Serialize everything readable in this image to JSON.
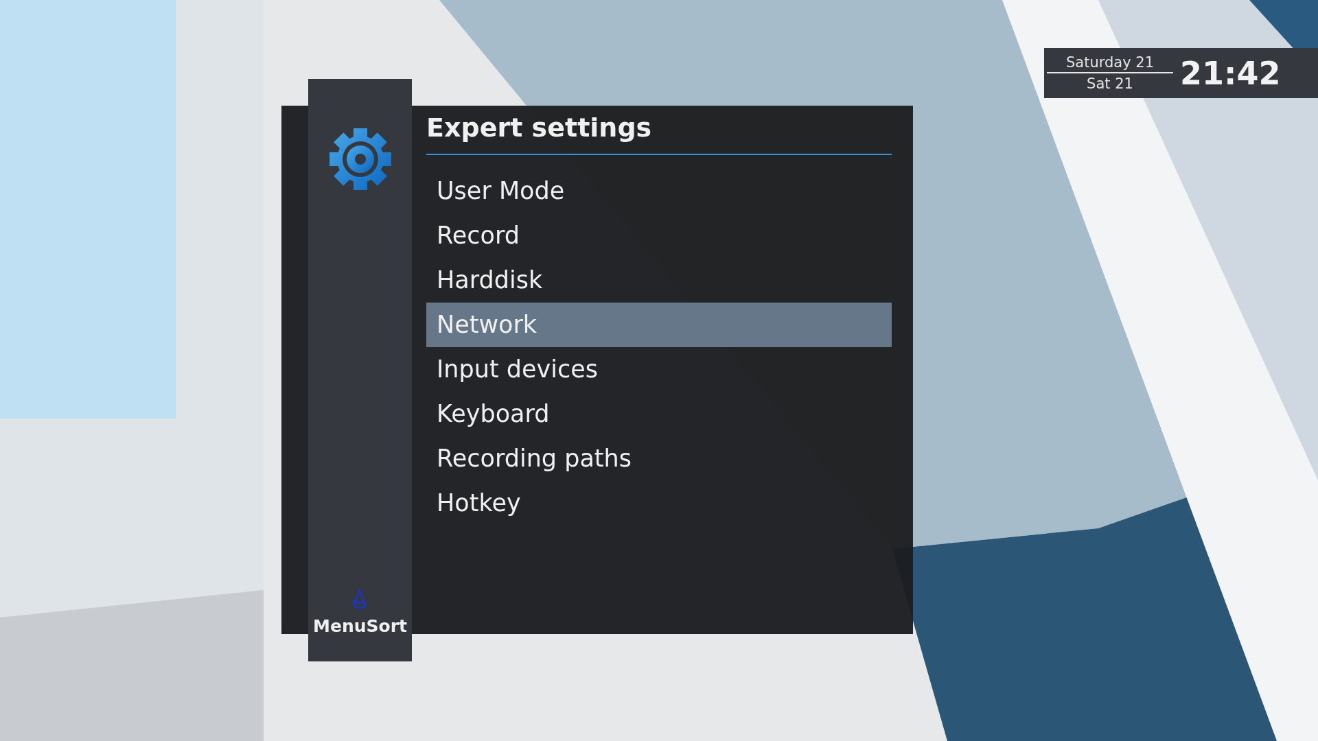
{
  "clock": {
    "date_long": "Saturday 21",
    "date_short": "Sat 21",
    "time": "21:42"
  },
  "sidebar": {
    "label": "MenuSort"
  },
  "menu": {
    "title": "Expert settings",
    "items": [
      {
        "label": "User Mode",
        "selected": false
      },
      {
        "label": "Record",
        "selected": false
      },
      {
        "label": "Harddisk",
        "selected": false
      },
      {
        "label": "Network",
        "selected": true
      },
      {
        "label": "Input devices",
        "selected": false
      },
      {
        "label": "Keyboard",
        "selected": false
      },
      {
        "label": "Recording paths",
        "selected": false
      },
      {
        "label": "Hotkey",
        "selected": false
      }
    ]
  }
}
